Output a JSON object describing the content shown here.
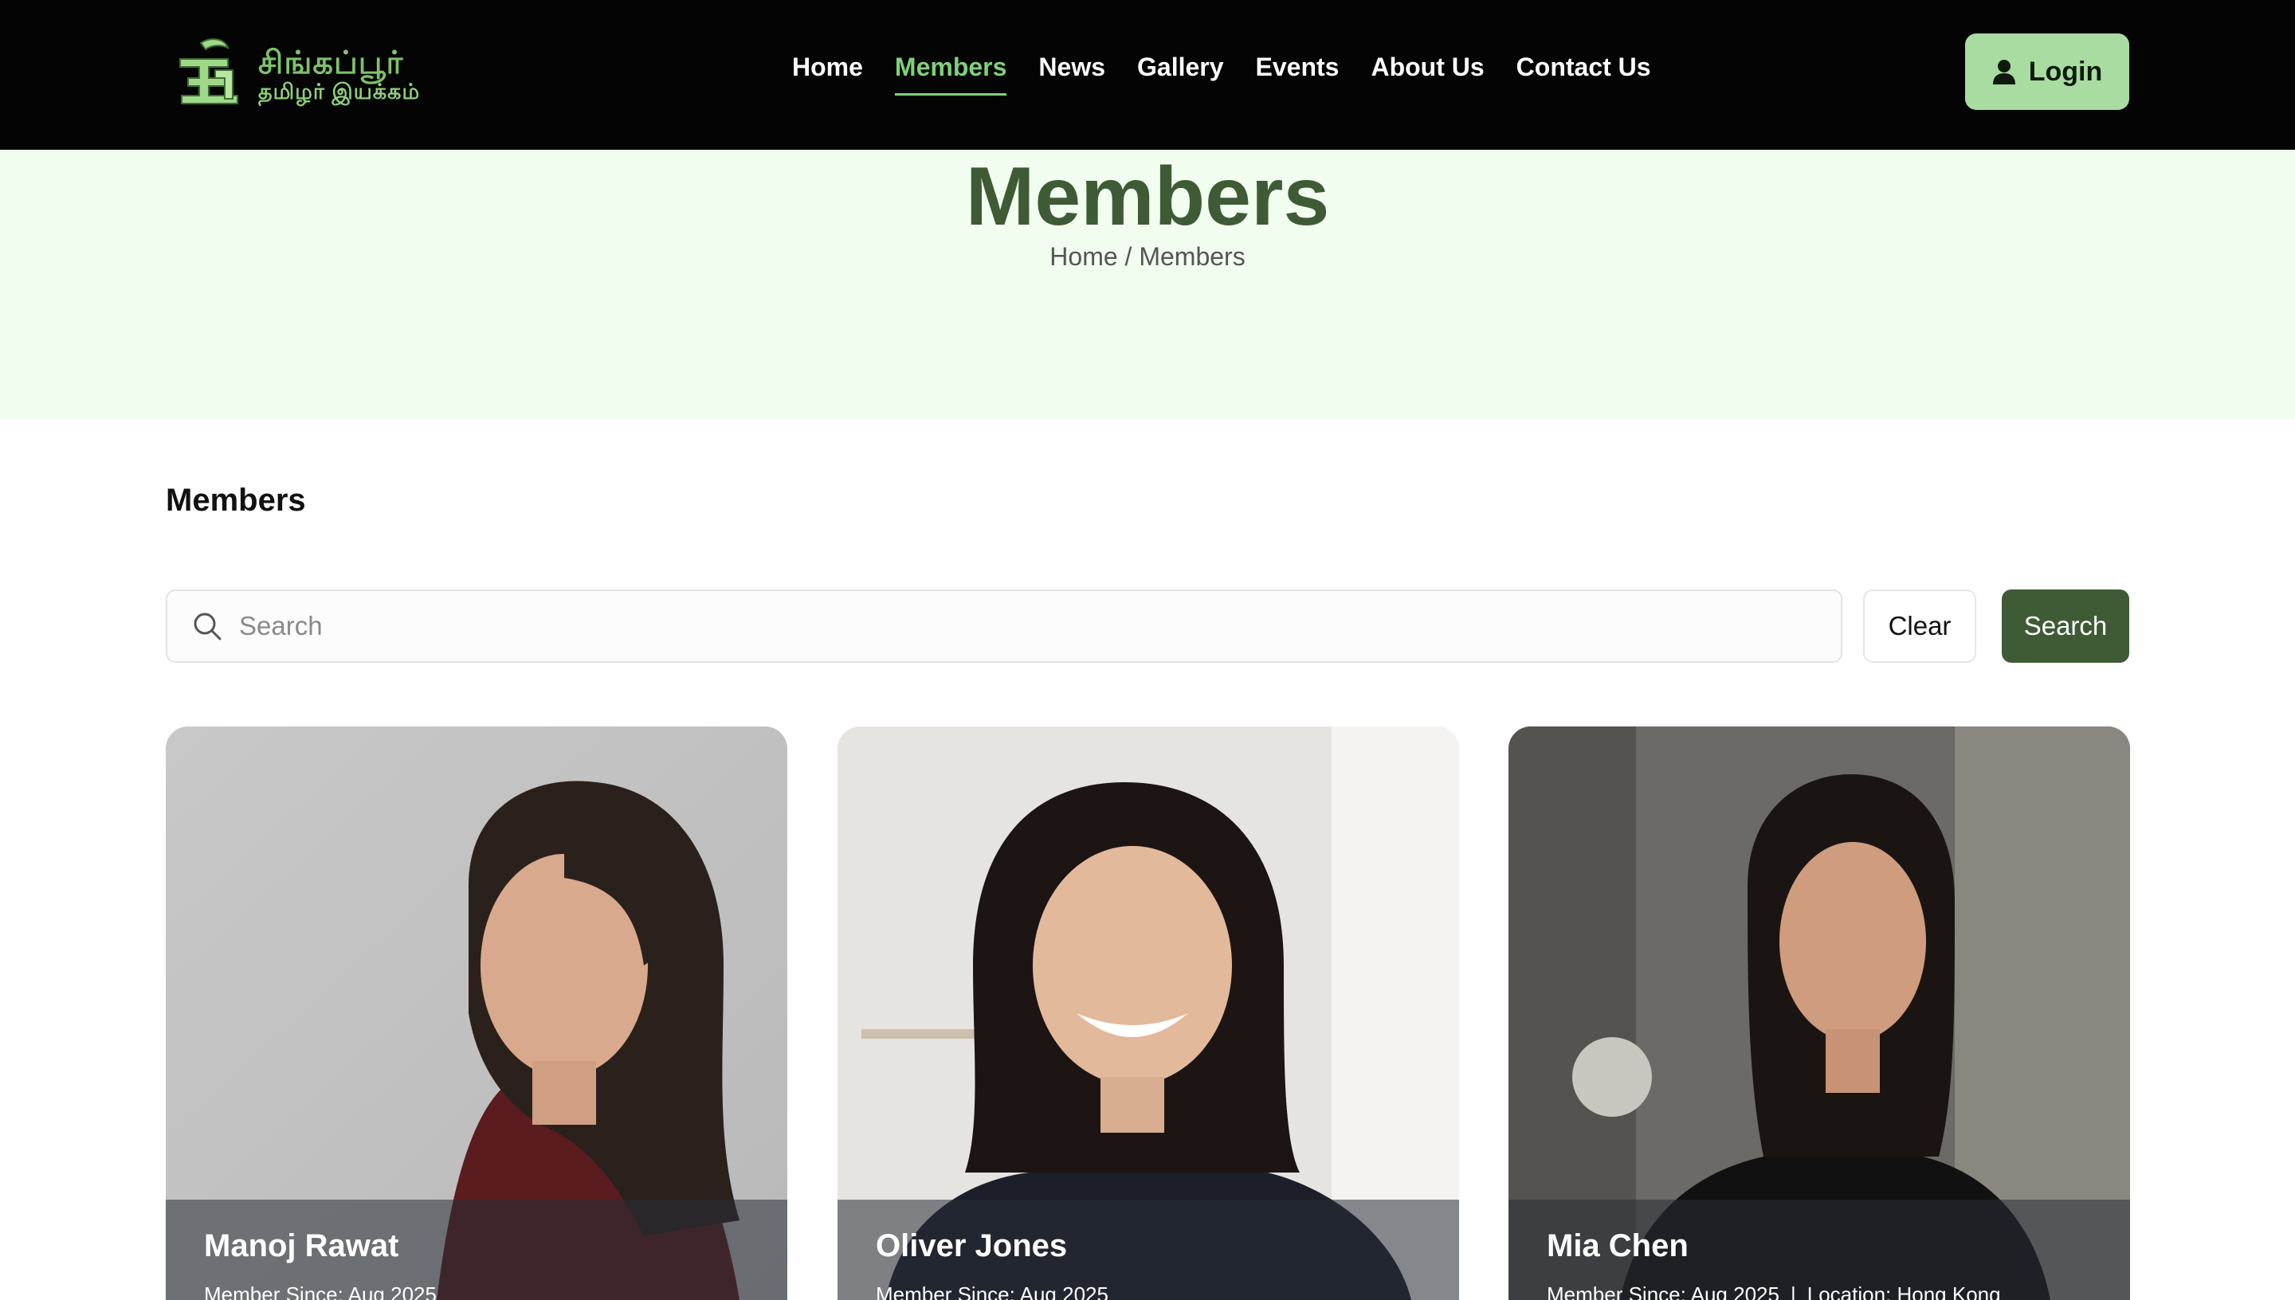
{
  "logo": {
    "line1": "சிங்கப்பூர்",
    "line2": "தமிழர் இயக்கம்"
  },
  "nav": {
    "items": [
      {
        "label": "Home",
        "active": false
      },
      {
        "label": "Members",
        "active": true
      },
      {
        "label": "News",
        "active": false
      },
      {
        "label": "Gallery",
        "active": false
      },
      {
        "label": "Events",
        "active": false
      },
      {
        "label": "About Us",
        "active": false
      },
      {
        "label": "Contact Us",
        "active": false
      }
    ],
    "login_label": "Login"
  },
  "hero": {
    "title": "Members",
    "breadcrumb_home": "Home",
    "breadcrumb_sep": "/",
    "breadcrumb_current": "Members"
  },
  "section": {
    "title": "Members"
  },
  "search": {
    "placeholder": "Search",
    "value": "",
    "clear_label": "Clear",
    "search_label": "Search"
  },
  "members": [
    {
      "name": "Manoj Rawat",
      "meta": "Member Since: Aug 2025",
      "location": ""
    },
    {
      "name": "Oliver Jones",
      "meta": "Member Since: Aug 2025",
      "location": ""
    },
    {
      "name": "Mia Chen",
      "meta": "Member Since: Aug 2025",
      "location": "Location: Hong Kong"
    }
  ],
  "colors": {
    "header_bg": "#040404",
    "accent_green": "#7fd17a",
    "login_bg": "#a8dca0",
    "hero_bg": "#f1fdef",
    "hero_title": "#3e5b36",
    "search_button_bg": "#3f5b35"
  }
}
